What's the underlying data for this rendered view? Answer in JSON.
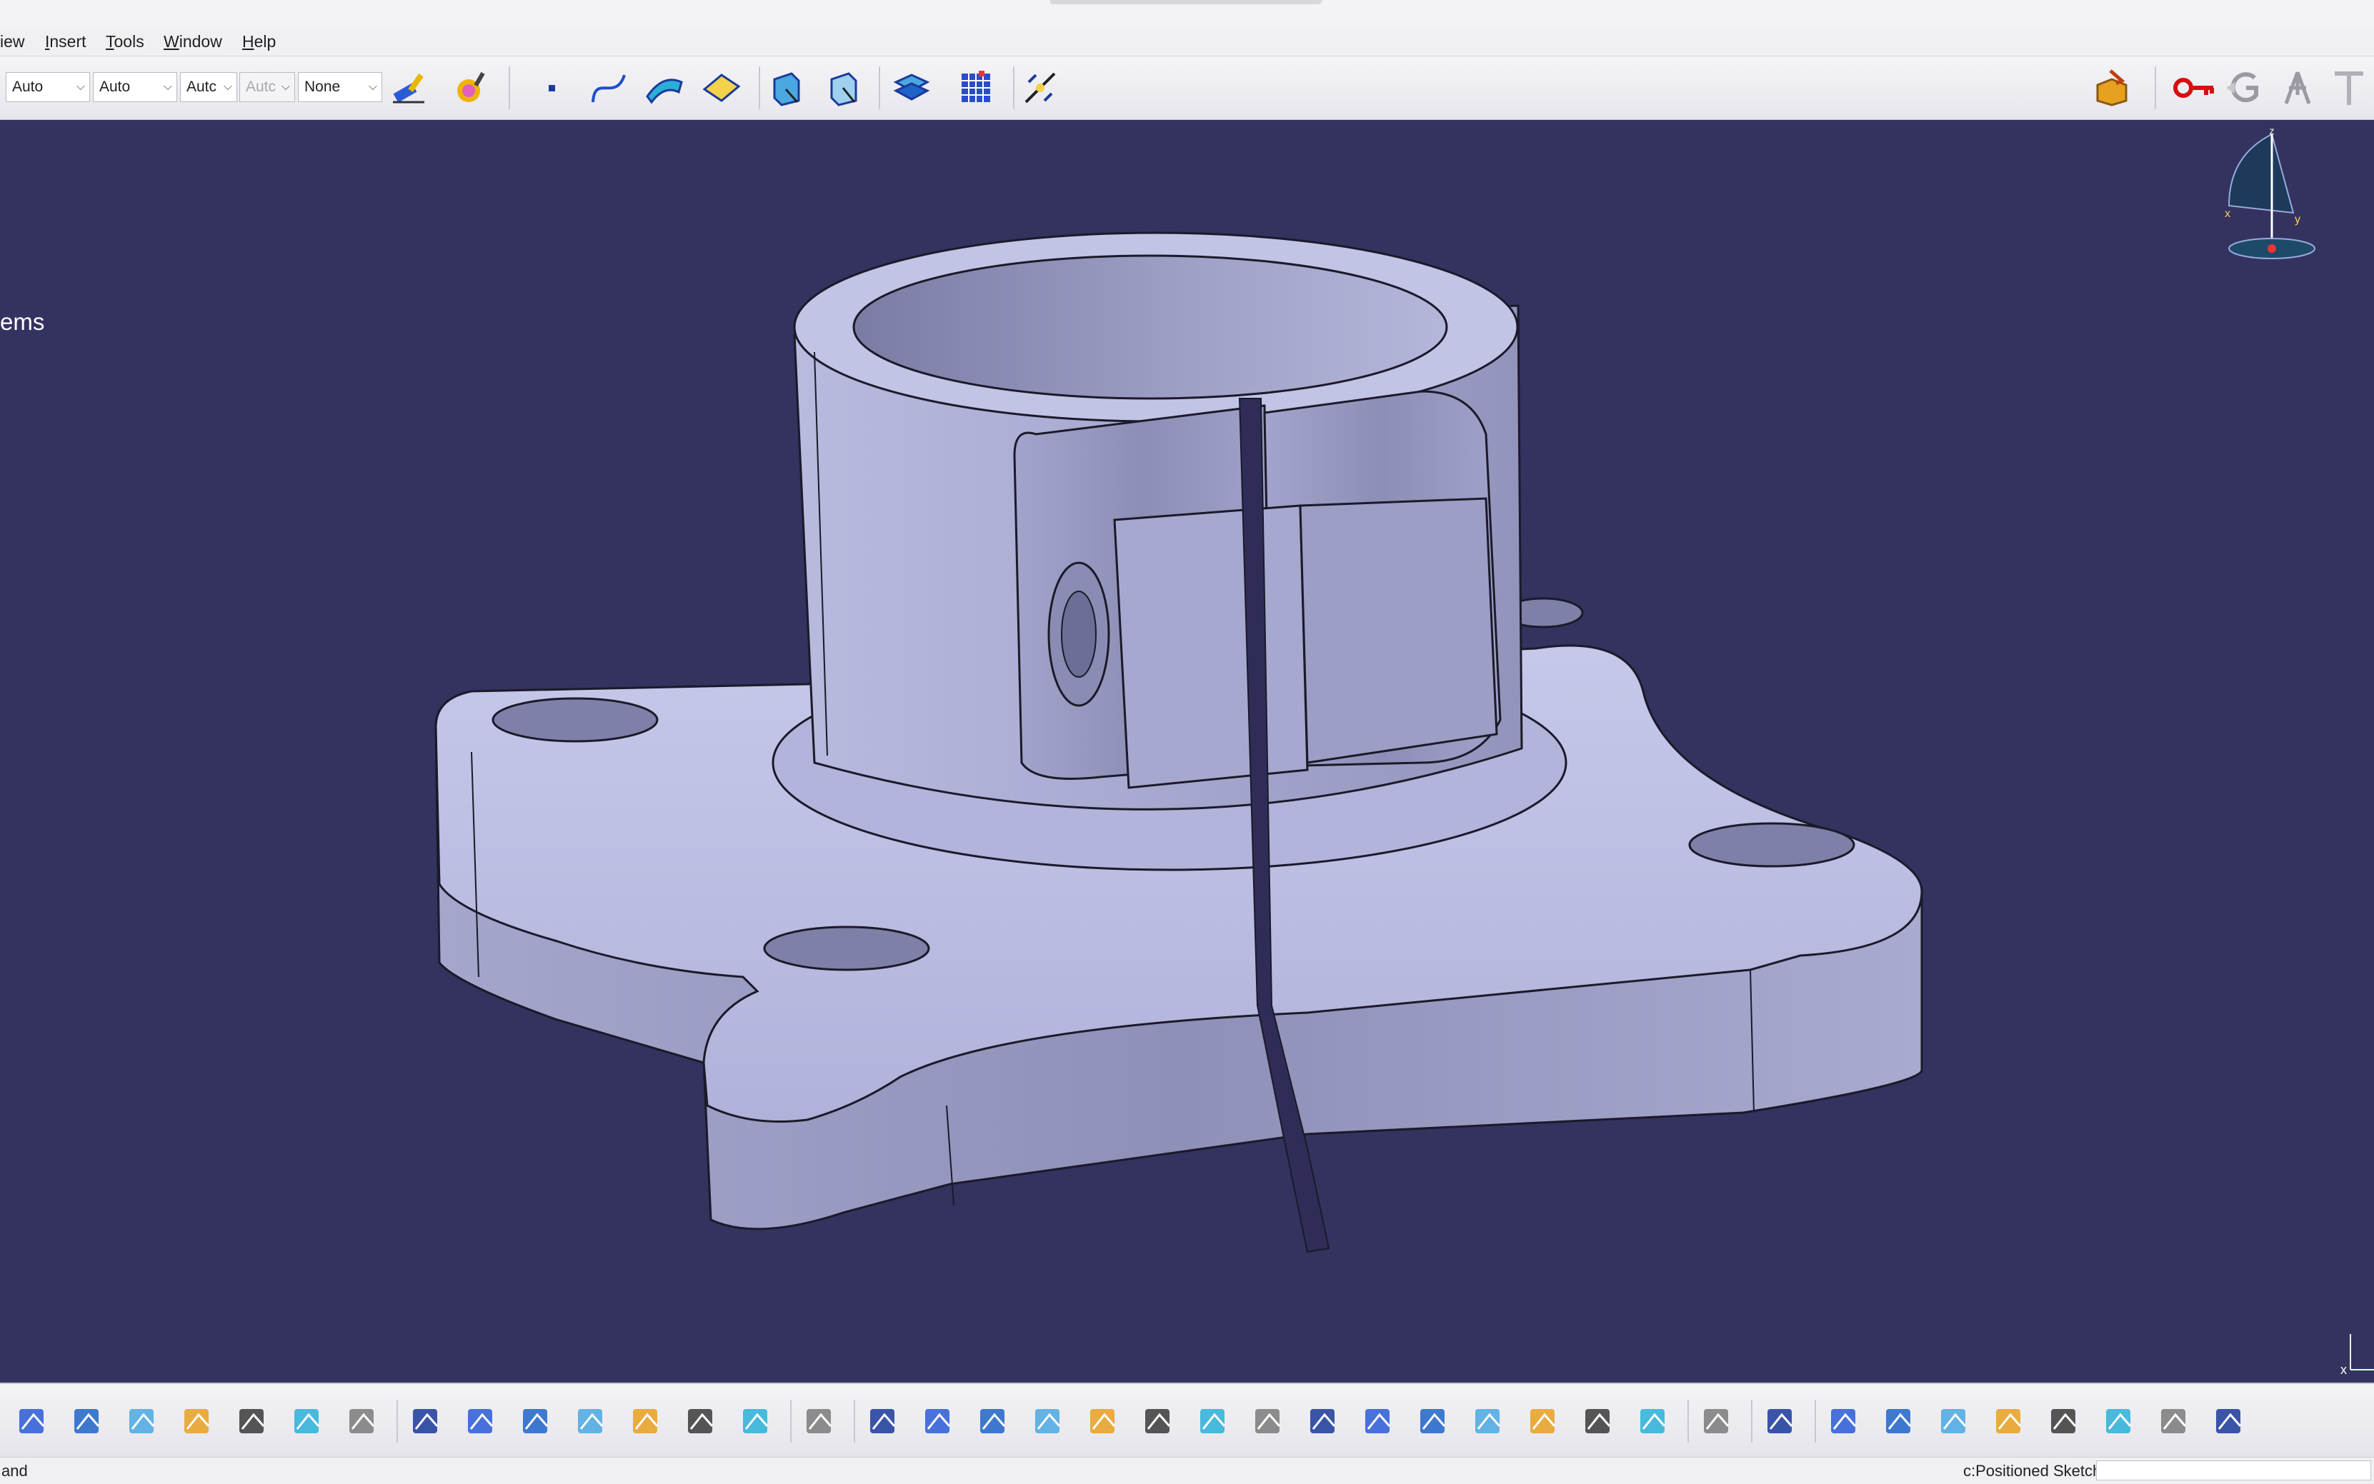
{
  "menu": {
    "items": [
      {
        "label": "iew",
        "accel": ""
      },
      {
        "label": "nsert",
        "accel": "I"
      },
      {
        "label": "ools",
        "accel": "T"
      },
      {
        "label": "indow",
        "accel": "W"
      },
      {
        "label": "elp",
        "accel": "H"
      }
    ]
  },
  "toolbar_top": {
    "combos": [
      "Auto",
      "Auto",
      "Autc",
      "Autc",
      "None"
    ],
    "icons": [
      "painter-brush-icon",
      "paint-roller-icon",
      "point-icon",
      "spline-icon",
      "surface-icon",
      "plane-icon",
      "iso-view-icon",
      "normal-view-icon",
      "multi-view-icon",
      "grid-icon",
      "snap-icon",
      "catalog-icon",
      "key-icon",
      "grayed-g-icon",
      "tree-figure-icon",
      "text-icon"
    ]
  },
  "viewport": {
    "side_text": "ems",
    "background": "#34325f",
    "model_color": "#b4b6dc"
  },
  "compass": {
    "x_label": "x",
    "y_label": "y",
    "z_label": "z"
  },
  "axis_corner": {
    "x_label": "x"
  },
  "toolbar_bottom": {
    "icons": [
      "print-icon",
      "cut-icon",
      "copy-icon",
      "paste-icon",
      "undo-icon",
      "redo-icon",
      "whats-this-icon",
      "formula-icon",
      "comment-icon",
      "bulb-icon",
      "table-icon",
      "tree-icon",
      "lock-icon",
      "knowledge-icon",
      "fly-icon",
      "fit-all-icon",
      "pan-icon",
      "rotate-icon",
      "zoom-in-icon",
      "zoom-out-icon",
      "normal-view-icon",
      "multi-view-icon",
      "iso-view-icon",
      "shading-icon",
      "hide-show-icon",
      "swap-visible-icon",
      "mechanical-icon",
      "measure-icon",
      "inertia-icon",
      "weight-icon",
      "capture-icon",
      "hierarchy-icon",
      "refresh-icon",
      "hand-icon",
      "axis-system-icon",
      "numeric-icon",
      "section-icon",
      "constraint-icon",
      "list-icon",
      "plane-icon"
    ]
  },
  "status": {
    "left": "and",
    "right": "c:Positioned Sketch"
  }
}
